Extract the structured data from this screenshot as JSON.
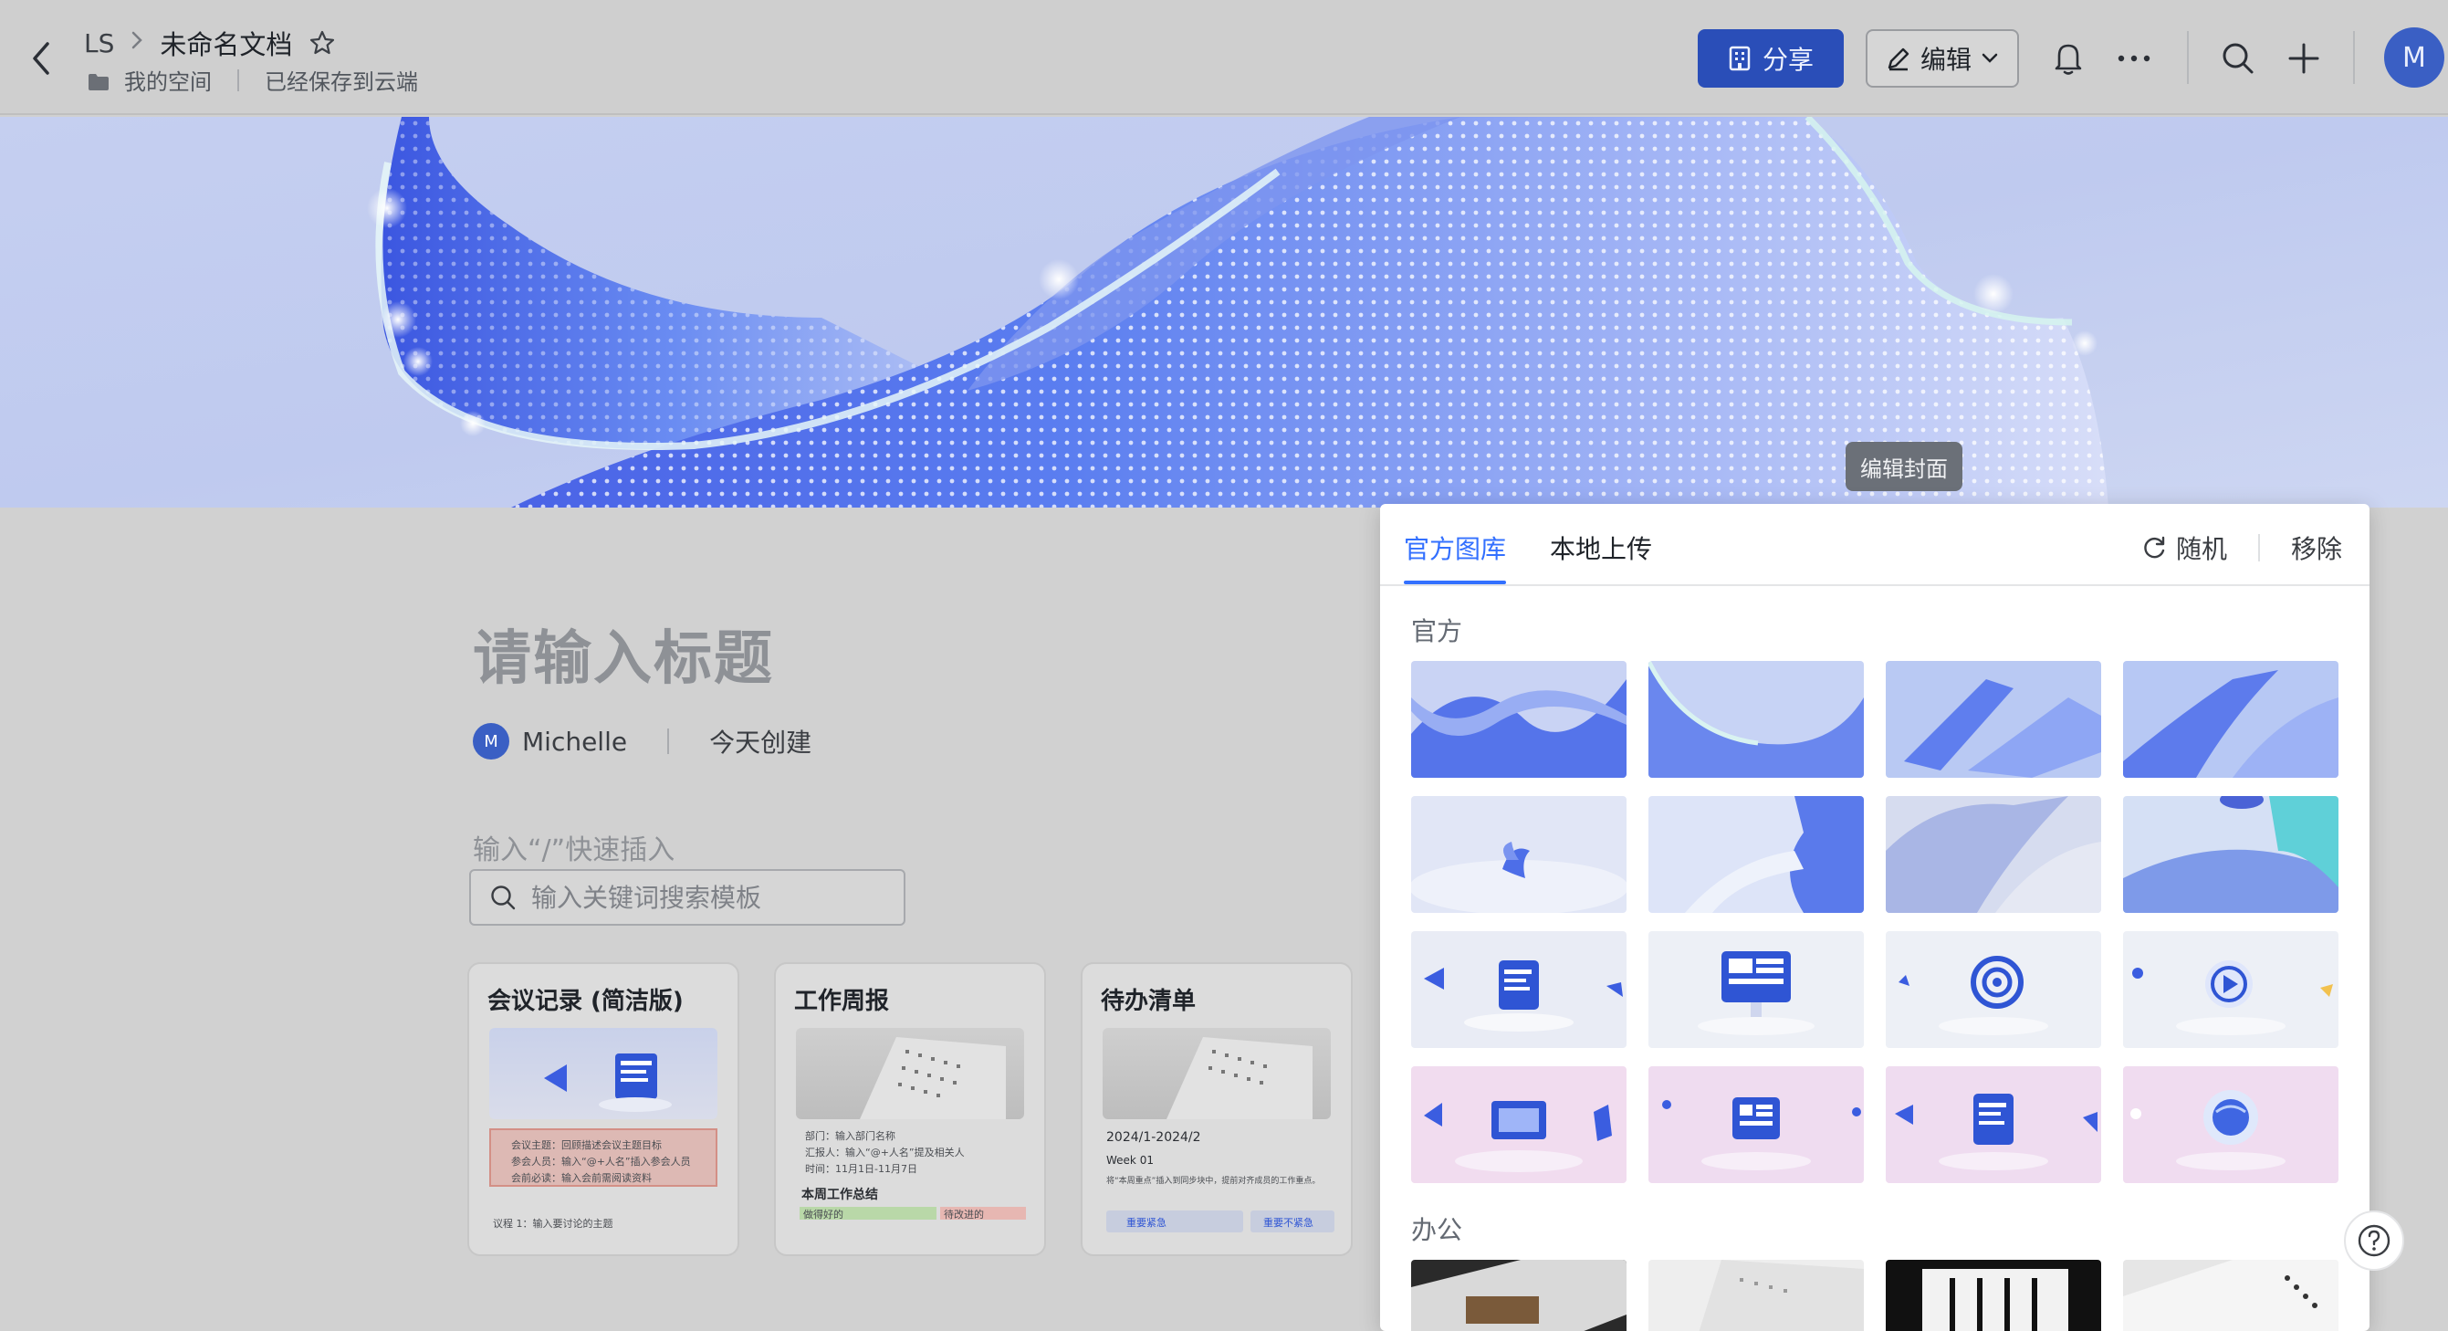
{
  "topbar": {
    "breadcrumb_root": "LS",
    "breadcrumb_sep": ">",
    "doc_title": "未命名文档",
    "location": "我的空间",
    "save_status": "已经保存到云端",
    "share_label": "分享",
    "edit_label": "编辑",
    "avatar_initial": "M"
  },
  "cover": {
    "edit_tip": "编辑封面"
  },
  "doc": {
    "title_placeholder": "请输入标题",
    "author_initial": "M",
    "author_name": "Michelle",
    "created": "今天创建",
    "insert_hint": "输入“/”快速插入",
    "search_placeholder": "输入关键词搜索模板"
  },
  "templates": [
    {
      "name": "会议记录 (简洁版)",
      "line1": "会议主题：回顾描述会议主题目标",
      "line2": "参会人员：输入“@+人名”插入参会人员",
      "line3": "会前必读：输入会前需阅读资料",
      "line4": "议程 1：输入要讨论的主题"
    },
    {
      "name": "工作周报",
      "line1": "部门：输入部门名称",
      "line2": "汇报人：输入“@+人名”提及相关人",
      "line3": "时间：11月1日-11月7日",
      "section": "本周工作总结",
      "col1": "做得好的",
      "col2": "待改进的"
    },
    {
      "name": "待办清单",
      "date": "2024/1-2024/2",
      "week": "Week 01",
      "line1": "将“本周重点”插入到同步块中，提前对齐成员的工作重点。",
      "tag1": "重要紧急",
      "tag2": "重要不紧急"
    }
  ],
  "panel": {
    "tab_official": "官方图库",
    "tab_upload": "本地上传",
    "random_label": "随机",
    "remove_label": "移除",
    "section_official": "官方",
    "section_office": "办公"
  },
  "colors": {
    "accent": "#3370ff",
    "share_button": "#2a4eb8",
    "avatar": "#3a5fc4"
  }
}
